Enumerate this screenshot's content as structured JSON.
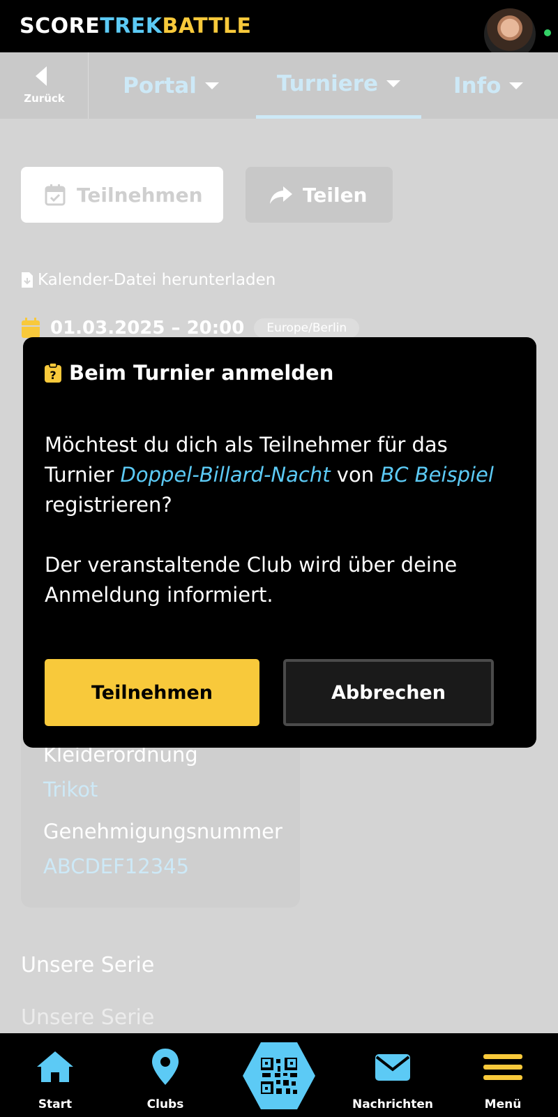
{
  "header": {
    "logo_part1": "SCORE",
    "logo_part2": "TREK",
    "logo_part3": "BATTLE",
    "online_status_color": "#33d166"
  },
  "nav": {
    "back_label": "Zurück",
    "tabs": [
      {
        "label": "Portal"
      },
      {
        "label": "Turniere",
        "active": true
      },
      {
        "label": "Info"
      }
    ]
  },
  "actions": {
    "join_label": "Teilnehmen",
    "share_label": "Teilen"
  },
  "event": {
    "calendar_download": "Kalender-Datei herunterladen",
    "datetime": "01.03.2025 – 20:00",
    "timezone": "Europe/Berlin"
  },
  "details": {
    "dress_code_label": "Kleiderordnung",
    "dress_code_value": "Trikot",
    "permit_label": "Genehmigungsnummer",
    "permit_value": "ABCDEF12345"
  },
  "series": {
    "heading": "Unsere Serie",
    "item": "Unsere Serie"
  },
  "modal": {
    "title": "Beim Turnier anmelden",
    "text_before": "Möchtest du dich als Teilnehmer für das Turnier ",
    "tournament_name": "Doppel-Billard-Nacht",
    "text_mid": " von ",
    "club_name": "BC Beispiel",
    "text_after": " registrieren?",
    "info_text": "Der veranstaltende Club wird über deine Anmeldung informiert.",
    "confirm_label": "Teilnehmen",
    "cancel_label": "Abbrechen"
  },
  "bottom_nav": {
    "start": "Start",
    "clubs": "Clubs",
    "messages": "Nachrichten",
    "menu": "Menü"
  },
  "colors": {
    "accent_blue": "#5ccaf5",
    "accent_yellow": "#f8c93b"
  }
}
